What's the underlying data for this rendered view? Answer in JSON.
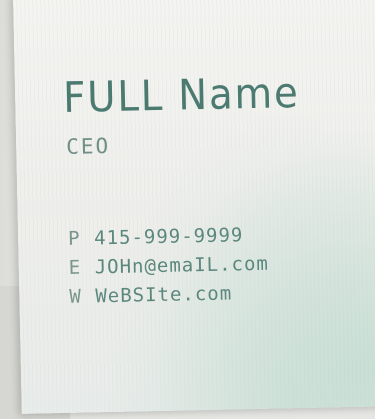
{
  "card": {
    "name": "FULL Name",
    "title": "CEO",
    "contacts": [
      {
        "letter": "P",
        "value": "415-999-9999"
      },
      {
        "letter": "E",
        "value": "JOHn@emaIL.com"
      },
      {
        "letter": "W",
        "value": "WeBSIte.com"
      }
    ]
  },
  "colors": {
    "text": "#4e7a70",
    "card": "#f1f1ee",
    "accent": "#b4d7c8"
  }
}
